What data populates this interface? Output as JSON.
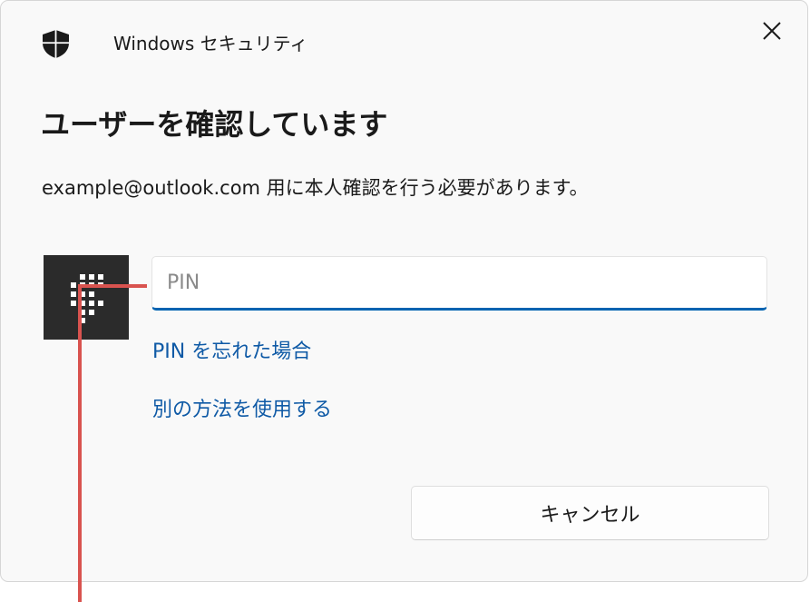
{
  "window": {
    "app_title": "Windows セキュリティ",
    "shield_icon": "shield-icon",
    "close_icon": "close-icon"
  },
  "main": {
    "heading": "ユーザーを確認しています",
    "subtext": "example@outlook.com 用に本人確認を行う必要があります。"
  },
  "pin": {
    "keypad_icon": "pin-keypad-icon",
    "placeholder": "PIN",
    "value": ""
  },
  "links": {
    "forgot_pin": "PIN を忘れた場合",
    "other_method": "別の方法を使用する"
  },
  "buttons": {
    "cancel": "キャンセル"
  },
  "colors": {
    "accent": "#0063b1",
    "link": "#0f5aa6",
    "callout": "#d9534f",
    "tile": "#2b2b2b"
  }
}
